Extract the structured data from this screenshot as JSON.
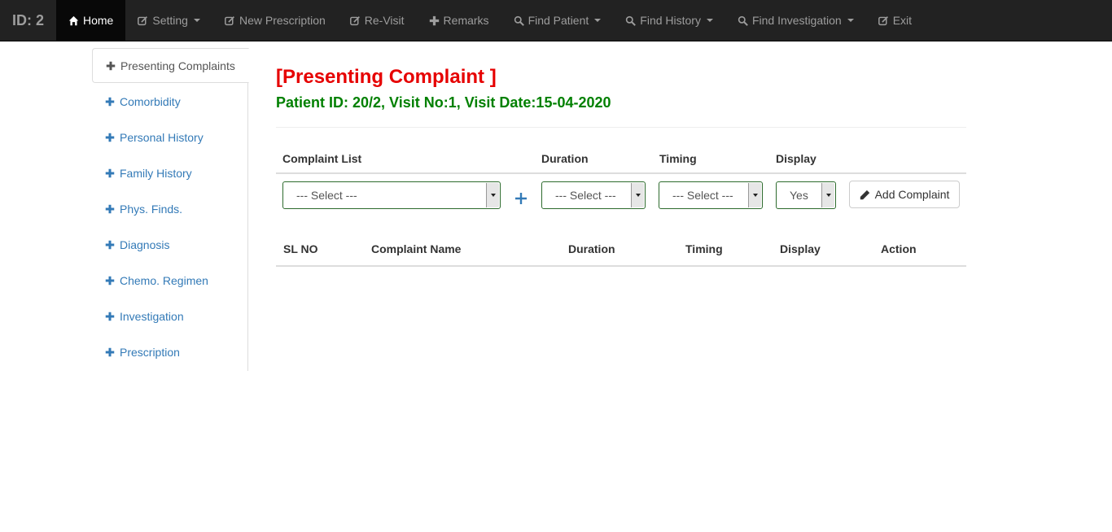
{
  "navbar": {
    "brand": "ID: 2",
    "items": [
      {
        "label": "Home",
        "icon": "home-icon"
      },
      {
        "label": "Setting",
        "icon": "edit-icon"
      },
      {
        "label": "New Prescription",
        "icon": "edit-icon"
      },
      {
        "label": "Re-Visit",
        "icon": "edit-icon"
      },
      {
        "label": "Remarks",
        "icon": "plus-icon"
      },
      {
        "label": "Find Patient",
        "icon": "search-icon"
      },
      {
        "label": "Find History",
        "icon": "search-icon"
      },
      {
        "label": "Find Investigation",
        "icon": "search-icon"
      },
      {
        "label": "Exit",
        "icon": "edit-icon"
      }
    ]
  },
  "sidebar": {
    "items": [
      {
        "label": "Presenting Complaints"
      },
      {
        "label": "Comorbidity"
      },
      {
        "label": "Personal History"
      },
      {
        "label": "Family History"
      },
      {
        "label": "Phys. Finds."
      },
      {
        "label": "Diagnosis"
      },
      {
        "label": "Chemo. Regimen"
      },
      {
        "label": "Investigation"
      },
      {
        "label": "Prescription"
      }
    ]
  },
  "main": {
    "title": "[Presenting Complaint ]",
    "subtitle": "Patient ID: 20/2,  Visit No:1, Visit Date:15-04-2020",
    "form": {
      "headers": {
        "complaint_list": "Complaint List",
        "duration": "Duration",
        "timing": "Timing",
        "display": "Display"
      },
      "complaint_select": "--- Select ---",
      "duration_select": "--- Select ---",
      "timing_select": "--- Select ---",
      "display_select": "Yes",
      "add_button": "Add Complaint"
    },
    "table": {
      "columns": [
        "SL NO",
        "Complaint Name",
        "Duration",
        "Timing",
        "Display",
        "Action"
      ],
      "rows": []
    }
  },
  "colors": {
    "navbar": "#222222",
    "title": "#e60000",
    "subtitle": "#008000",
    "link": "#337ab7"
  }
}
